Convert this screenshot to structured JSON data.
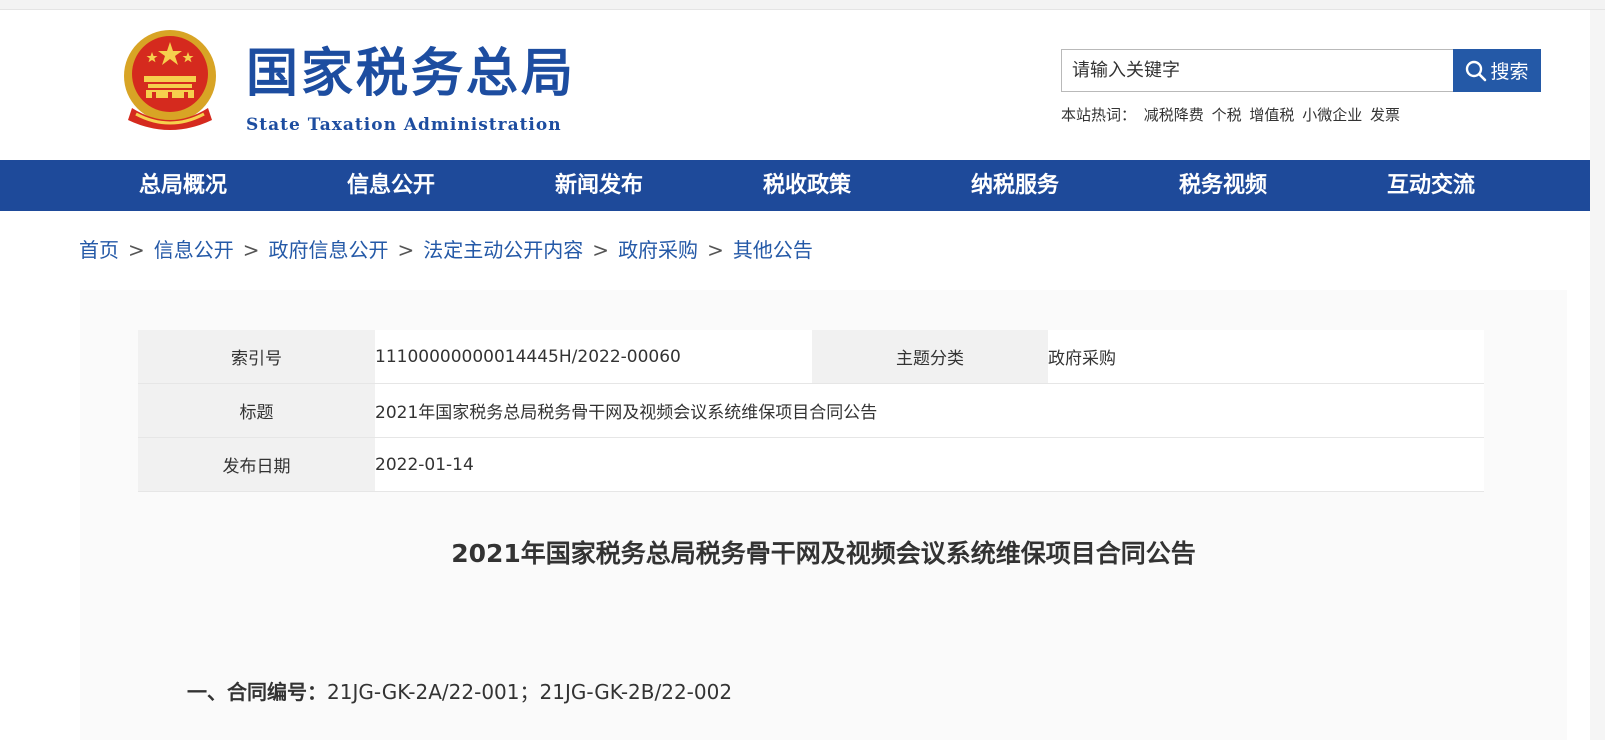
{
  "header": {
    "logo_cn": "国家税务总局",
    "logo_en": "State Taxation Administration",
    "search_placeholder": "请输入关键字",
    "search_button": "搜索",
    "hot_label": "本站热词：",
    "hot_words": [
      "减税降费",
      "个税",
      "增值税",
      "小微企业",
      "发票"
    ]
  },
  "nav": {
    "items": [
      "总局概况",
      "信息公开",
      "新闻发布",
      "税收政策",
      "纳税服务",
      "税务视频",
      "互动交流"
    ]
  },
  "breadcrumb": {
    "items": [
      "首页",
      "信息公开",
      "政府信息公开",
      "法定主动公开内容",
      "政府采购",
      "其他公告"
    ],
    "separator": ">"
  },
  "meta": {
    "index_label": "索引号",
    "index_value": "11100000000014445H/2022-00060",
    "topic_label": "主题分类",
    "topic_value": "政府采购",
    "title_label": "标题",
    "title_value": "2021年国家税务总局税务骨干网及视频会议系统维保项目合同公告",
    "date_label": "发布日期",
    "date_value": "2022-01-14"
  },
  "article": {
    "title": "2021年国家税务总局税务骨干网及视频会议系统维保项目合同公告",
    "section1_label": "一、合同编号：",
    "section1_value": "21JG-GK-2A/22-001；21JG-GK-2B/22-002"
  },
  "colors": {
    "brand_blue": "#1d4da0",
    "nav_bg": "#1e4a9a",
    "search_button_bg": "#2459a7",
    "link_blue": "#2459a7"
  },
  "icons": {
    "emblem": "national-emblem-icon",
    "search": "search-icon"
  }
}
